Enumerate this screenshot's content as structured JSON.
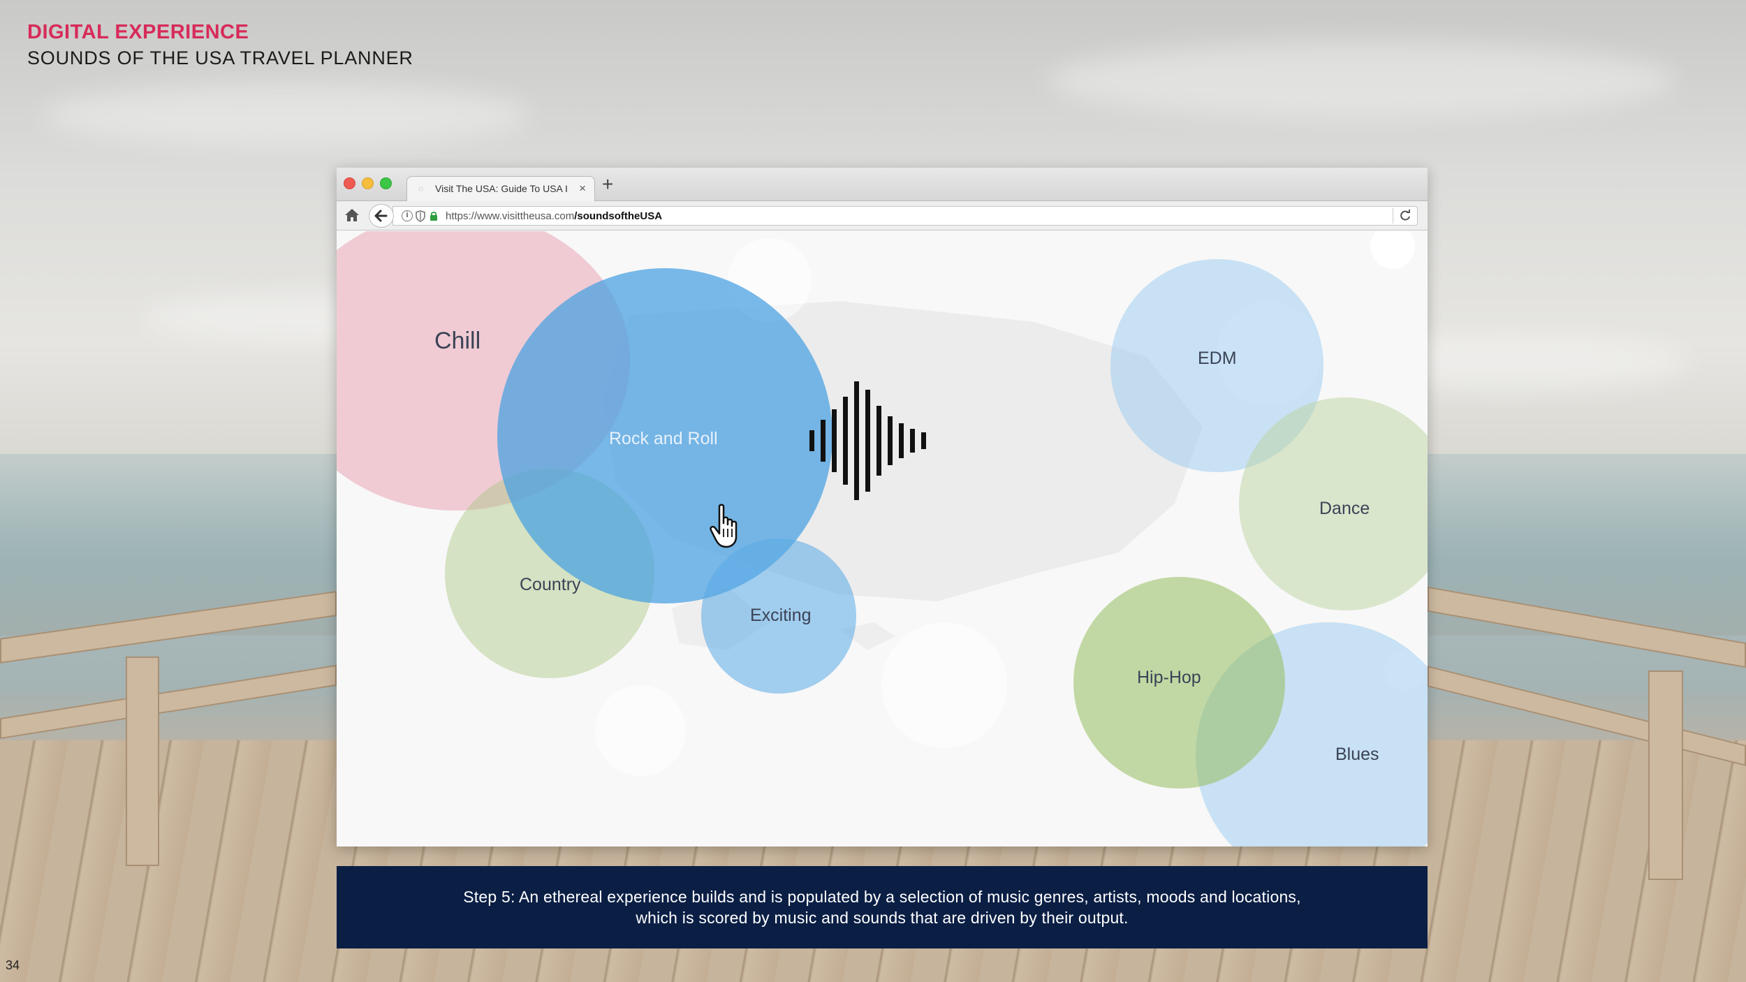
{
  "slide": {
    "category": "DIGITAL EXPERIENCE",
    "title": "SOUNDS OF THE USA TRAVEL PLANNER",
    "page_number": "34",
    "caption_line1": "Step 5: An ethereal experience builds and is populated by a selection of music genres, artists, moods and locations,",
    "caption_line2": "which is scored by music and sounds that are driven by their output.",
    "accent_color": "#d72b5a",
    "caption_bg": "#0b1f45"
  },
  "browser": {
    "tab_title": "Visit The USA: Guide To USA I",
    "tab_close": "×",
    "new_tab": "+",
    "url_domain": "https://www.visittheusa.com",
    "url_path": "/soundsoftheUSA"
  },
  "bubbles": {
    "chill": "Chill",
    "rock": "Rock and Roll",
    "country": "Country",
    "exciting": "Exciting",
    "edm": "EDM",
    "dance": "Dance",
    "hiphop": "Hip-Hop",
    "blues": "Blues"
  },
  "icons": {
    "home": "home-icon",
    "back": "arrow-left-icon",
    "info": "info-icon",
    "shield": "shield-icon",
    "lock": "lock-icon",
    "reload": "reload-icon",
    "soundwave": "soundwave-icon",
    "cursor": "hand-pointer-icon"
  }
}
